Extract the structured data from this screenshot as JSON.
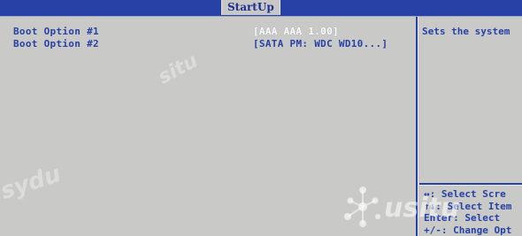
{
  "header": {
    "active_tab": "StartUp"
  },
  "boot_options": [
    {
      "label": "Boot Option #1",
      "value": "[AAA AAA 1.00]"
    },
    {
      "label": "Boot Option #2",
      "value": "[SATA  PM: WDC WD10...]"
    }
  ],
  "help": {
    "description": "Sets the system",
    "keys": [
      "↔: Select Scre",
      "↑↓: Select Item",
      "Enter: Select",
      "+/-: Change Opt"
    ]
  },
  "watermark": {
    "logo_text": "usitu",
    "text_left": "sydu",
    "text_mid": "situ"
  },
  "colors": {
    "bios_blue": "#2741a6",
    "background_gray": "#c9cac8",
    "highlight_white": "#ffffff"
  }
}
